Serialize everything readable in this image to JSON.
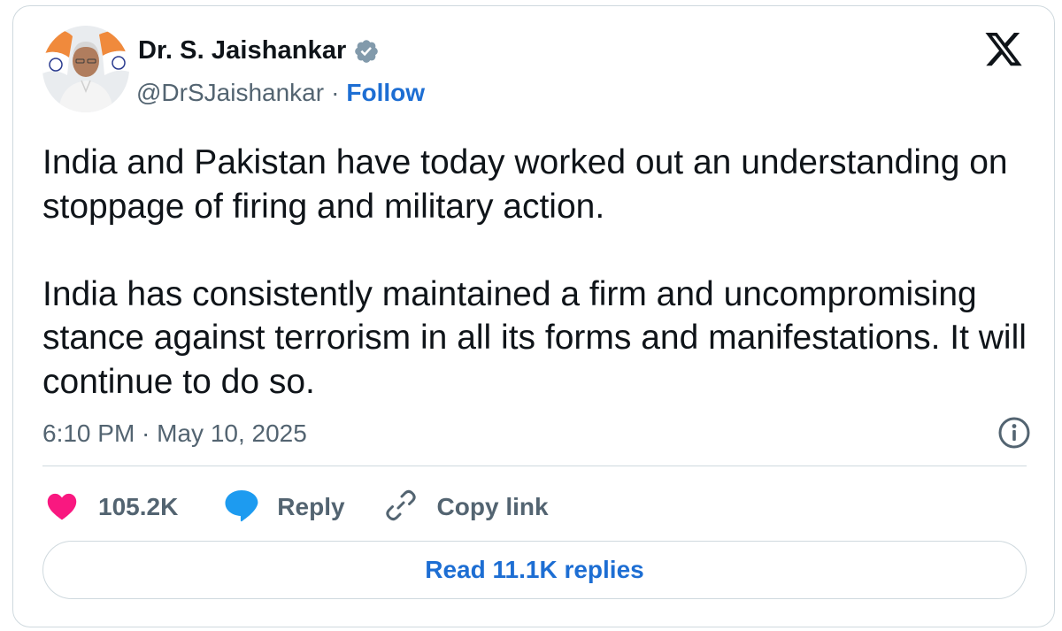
{
  "author": {
    "name": "Dr. S. Jaishankar",
    "handle": "@DrSJaishankar",
    "separator": "·",
    "follow_label": "Follow",
    "verified_icon": "verified-badge-icon",
    "avatar_icon": "profile-photo"
  },
  "platform_logo": "x-logo-icon",
  "tweet": {
    "paragraph_1": "India and Pakistan have today worked out an understanding on stoppage of firing and military action.",
    "paragraph_2": "India has consistently maintained a firm and uncompromising stance against terrorism in all its forms and manifestations. It will continue to do so."
  },
  "timestamp": "6:10 PM · May 10, 2025",
  "info_icon": "info-icon",
  "actions": {
    "likes_count": "105.2K",
    "reply_label": "Reply",
    "copy_link_label": "Copy link"
  },
  "read_replies_label": "Read 11.1K replies",
  "colors": {
    "text_primary": "#0f1419",
    "text_secondary": "#536471",
    "link_blue": "#1d6ed3",
    "heart_pink": "#f91880",
    "reply_blue": "#1d9bf0",
    "border": "#cfd9de",
    "verified_gray": "#829aab"
  }
}
